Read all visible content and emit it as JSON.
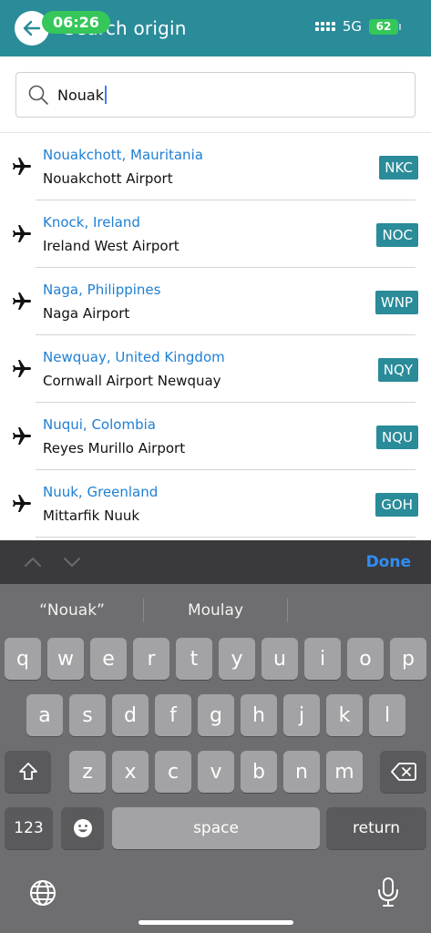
{
  "status_bar": {
    "time": "06:26",
    "network": "5G",
    "battery": "62"
  },
  "header": {
    "title": "Search origin"
  },
  "search": {
    "value": "Nouak"
  },
  "results": [
    {
      "city": "Nouakchott, Mauritania",
      "airport": "Nouakchott Airport",
      "code": "NKC"
    },
    {
      "city": "Knock, Ireland",
      "airport": "Ireland West Airport",
      "code": "NOC"
    },
    {
      "city": "Naga, Philippines",
      "airport": "Naga Airport",
      "code": "WNP"
    },
    {
      "city": "Newquay, United Kingdom",
      "airport": "Cornwall Airport Newquay",
      "code": "NQY"
    },
    {
      "city": "Nuqui, Colombia",
      "airport": "Reyes Murillo Airport",
      "code": "NQU"
    },
    {
      "city": "Nuuk, Greenland",
      "airport": "Mittarfik Nuuk",
      "code": "GOH"
    }
  ],
  "keyboard": {
    "done_label": "Done",
    "suggestions": [
      "“Nouak”",
      "Moulay"
    ],
    "row1": [
      "q",
      "w",
      "e",
      "r",
      "t",
      "y",
      "u",
      "i",
      "o",
      "p"
    ],
    "row2": [
      "a",
      "s",
      "d",
      "f",
      "g",
      "h",
      "j",
      "k",
      "l"
    ],
    "row3": [
      "z",
      "x",
      "c",
      "v",
      "b",
      "n",
      "m"
    ],
    "numbers_label": "123",
    "space_label": "space",
    "return_label": "return"
  },
  "colors": {
    "header": "#2a8b99",
    "link": "#1e7fd3",
    "badge": "#2a8b99",
    "done": "#2e8ef5",
    "time_pill": "#35c759"
  }
}
